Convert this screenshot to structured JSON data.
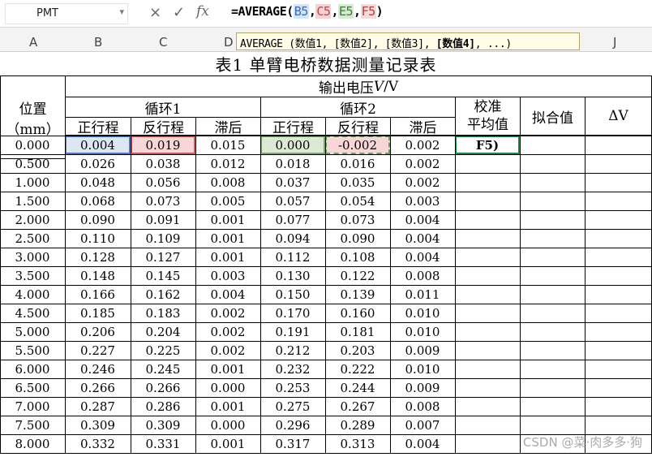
{
  "formula_bar": {
    "name_box": "PMT",
    "name_box_arrow": "▾",
    "cancel_icon": "×",
    "confirm_icon": "✓",
    "fx_label": "fx",
    "formula_prefix": "=AVERAGE(",
    "refs": [
      "B5",
      "C5",
      "E5",
      "F5"
    ],
    "sep": ",",
    "formula_suffix": ")"
  },
  "tooltip": {
    "func": "AVERAGE",
    "args": " (数值1, [数值2], [数值3], ",
    "current_arg": "[数值4]",
    "tail": ", ...)"
  },
  "column_headers": [
    "A",
    "B",
    "C",
    "D",
    "E",
    "F",
    "G",
    "H",
    "I",
    "J"
  ],
  "table": {
    "title": "表1  单臂电桥数据测量记录表",
    "position_label": "位置",
    "position_unit": "（mm）",
    "output_voltage": "输出电压",
    "output_voltage_sym": "V",
    "output_voltage_unit": "/V",
    "cycle1": "循环1",
    "cycle2": "循环2",
    "forward": "正行程",
    "reverse": "反行程",
    "hysteresis": "滞后",
    "calib_avg_line1": "校准",
    "calib_avg_line2": "平均值",
    "fit_value": "拟合值",
    "delta_v": "ΔV",
    "active_cell_text": "F5)",
    "rows": [
      [
        "0.000",
        "0.004",
        "0.019",
        "0.015",
        "0.000",
        "-0.002",
        "0.002"
      ],
      [
        "0.500",
        "0.026",
        "0.038",
        "0.012",
        "0.018",
        "0.016",
        "0.002"
      ],
      [
        "1.000",
        "0.048",
        "0.056",
        "0.008",
        "0.037",
        "0.035",
        "0.002"
      ],
      [
        "1.500",
        "0.068",
        "0.073",
        "0.005",
        "0.057",
        "0.054",
        "0.003"
      ],
      [
        "2.000",
        "0.090",
        "0.091",
        "0.001",
        "0.077",
        "0.073",
        "0.004"
      ],
      [
        "2.500",
        "0.110",
        "0.109",
        "0.001",
        "0.094",
        "0.090",
        "0.004"
      ],
      [
        "3.000",
        "0.128",
        "0.127",
        "0.001",
        "0.112",
        "0.108",
        "0.004"
      ],
      [
        "3.500",
        "0.148",
        "0.145",
        "0.003",
        "0.130",
        "0.122",
        "0.008"
      ],
      [
        "4.000",
        "0.166",
        "0.162",
        "0.004",
        "0.150",
        "0.139",
        "0.011"
      ],
      [
        "4.500",
        "0.185",
        "0.183",
        "0.002",
        "0.170",
        "0.160",
        "0.010"
      ],
      [
        "5.000",
        "0.206",
        "0.204",
        "0.002",
        "0.191",
        "0.181",
        "0.010"
      ],
      [
        "5.500",
        "0.227",
        "0.225",
        "0.002",
        "0.212",
        "0.203",
        "0.009"
      ],
      [
        "6.000",
        "0.246",
        "0.245",
        "0.001",
        "0.232",
        "0.222",
        "0.010"
      ],
      [
        "6.500",
        "0.266",
        "0.266",
        "0.000",
        "0.253",
        "0.244",
        "0.009"
      ],
      [
        "7.000",
        "0.287",
        "0.286",
        "0.001",
        "0.275",
        "0.267",
        "0.008"
      ],
      [
        "7.500",
        "0.309",
        "0.309",
        "0.000",
        "0.296",
        "0.289",
        "0.007"
      ],
      [
        "8.000",
        "0.332",
        "0.331",
        "0.001",
        "0.317",
        "0.313",
        "0.004"
      ]
    ]
  },
  "watermark": "CSDN @菜·肉多多·狗"
}
